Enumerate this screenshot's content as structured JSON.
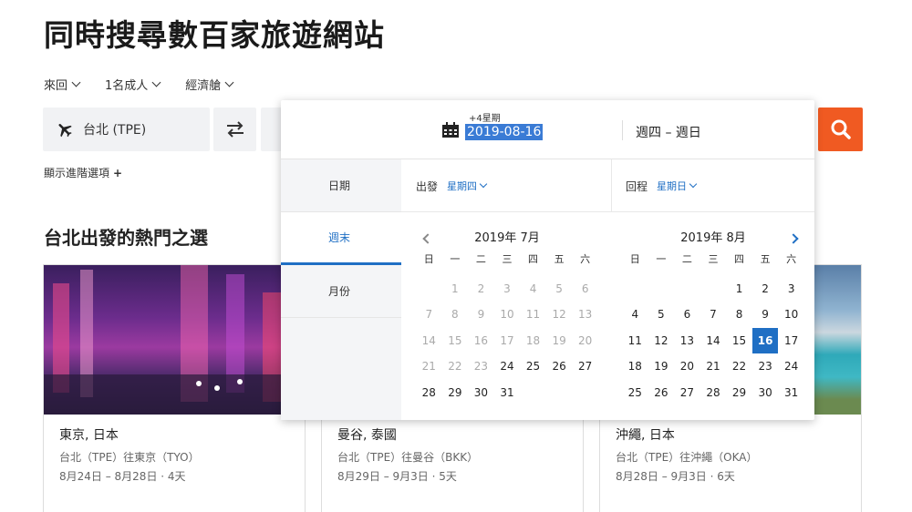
{
  "headline": "同時搜尋數百家旅遊網站",
  "options": {
    "trip_type": "來回",
    "travelers": "1名成人",
    "cabin": "經濟艙"
  },
  "origin": {
    "value": "台北 (TPE)"
  },
  "advanced_link": "顯示進階選項",
  "advanced_plus": "+",
  "section_title": "台北出發的熱門之選",
  "cards": [
    {
      "city": "東京, 日本",
      "route": "台北（TPE）往東京（TYO）",
      "dates": "8月24日 – 8月28日 · 4天"
    },
    {
      "city": "曼谷, 泰國",
      "route": "台北（TPE）往曼谷（BKK）",
      "dates": "8月29日 – 9月3日 · 5天"
    },
    {
      "city": "沖繩, 日本",
      "route": "台北（TPE）往沖繩（OKA）",
      "dates": "8月28日 – 9月3日 · 6天"
    }
  ],
  "picker": {
    "flex_label": "+4星期",
    "date_value": "2019-08-16",
    "range_text": "週四 – 週日",
    "tabs": [
      "日期",
      "週末",
      "月份"
    ],
    "depart_label": "出發",
    "depart_value": "星期四",
    "return_label": "回程",
    "return_value": "星期日",
    "weekdays": [
      "日",
      "一",
      "二",
      "三",
      "四",
      "五",
      "六"
    ],
    "months": [
      {
        "title": "2019年 7月",
        "offset": 1,
        "days": [
          "1",
          "2",
          "3",
          "4",
          "5",
          "6",
          "7",
          "8",
          "9",
          "10",
          "11",
          "12",
          "13",
          "14",
          "15",
          "16",
          "17",
          "18",
          "19",
          "20",
          "21",
          "22",
          "23",
          "24",
          "25",
          "26",
          "27",
          "28",
          "29",
          "30",
          "31"
        ],
        "past_until": 23,
        "selected": null
      },
      {
        "title": "2019年 8月",
        "offset": 4,
        "days": [
          "1",
          "2",
          "3",
          "4",
          "5",
          "6",
          "7",
          "8",
          "9",
          "10",
          "11",
          "12",
          "13",
          "14",
          "15",
          "16",
          "17",
          "18",
          "19",
          "20",
          "21",
          "22",
          "23",
          "24",
          "25",
          "26",
          "27",
          "28",
          "29",
          "30",
          "31"
        ],
        "past_until": 0,
        "selected": 16
      }
    ]
  },
  "colors": {
    "accent": "#1f6fc4",
    "search_button": "#f05a22"
  }
}
